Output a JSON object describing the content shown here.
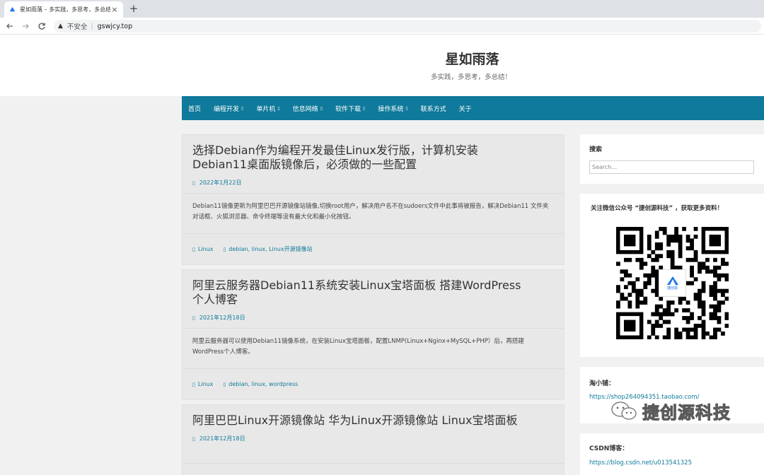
{
  "browser": {
    "tab_title": "星如雨落 – 多实践，多思考，多总结！",
    "tab_close": "×",
    "new_tab": "+",
    "address": {
      "security_label": "不安全",
      "separator": "|",
      "url": "gswjcy.top"
    }
  },
  "site": {
    "title": "星如雨落",
    "description": "多实践，多思考，多总结！"
  },
  "nav": {
    "items": [
      {
        "label": "首页",
        "has_dropdown": false
      },
      {
        "label": "编程开发",
        "has_dropdown": true
      },
      {
        "label": "单片机",
        "has_dropdown": true
      },
      {
        "label": "信息网络",
        "has_dropdown": true
      },
      {
        "label": "软件下载",
        "has_dropdown": true
      },
      {
        "label": "操作系统",
        "has_dropdown": true
      },
      {
        "label": "联系方式",
        "has_dropdown": false
      },
      {
        "label": "关于",
        "has_dropdown": false
      }
    ],
    "caret": "▯"
  },
  "posts": [
    {
      "title": "选择Debian作为编程开发最佳Linux发行版，计算机安装Debian11桌面版镜像后，必须做的一些配置",
      "date": "2022年1月22日",
      "excerpt": "Debian11镜像更新为阿里巴巴开源镜像站镜像,切换root用户，解决用户名不在sudoers文件中此事将被报告，解决Debian11 文件夹对话框、火狐浏览器、命令终端等没有最大化和最小化按钮。",
      "category": "Linux",
      "tags": "debian, linux, Linux开源镜像站"
    },
    {
      "title": "阿里云服务器Debian11系统安装Linux宝塔面板 搭建WordPress个人博客",
      "date": "2021年12月18日",
      "excerpt": "阿里云服务器可以使用Debian11镜像系统，在安装Linux宝塔面板，配置LNMP(Linux+Nginx+MySQL+PHP）后，再搭建WordPress个人博客。",
      "category": "Linux",
      "tags": "debian, linux, wordpress"
    },
    {
      "title": "阿里巴巴Linux开源镜像站 华为Linux开源镜像站 Linux宝塔面板",
      "date": "2021年12月18日",
      "excerpt": "",
      "category": "",
      "tags": ""
    }
  ],
  "post_icon_glyph": "▯",
  "sidebar": {
    "search": {
      "title": "搜索",
      "placeholder": "Search..."
    },
    "wechat": {
      "title": "关注微信公众号 “捷创源科技” ，获取更多资料！",
      "qr_center_label": "捷创源"
    },
    "taobao": {
      "title": "淘小铺：",
      "url": "https://shop264094351.taobao.com/"
    },
    "csdn": {
      "title": "CSDN博客：",
      "url": "https://blog.csdn.net/u013541325"
    }
  },
  "watermark": {
    "text": "捷创源科技"
  },
  "colors": {
    "accent": "#0f7a9b",
    "page_bg": "#f1f1f1",
    "post_bg": "#e8e8e8"
  }
}
